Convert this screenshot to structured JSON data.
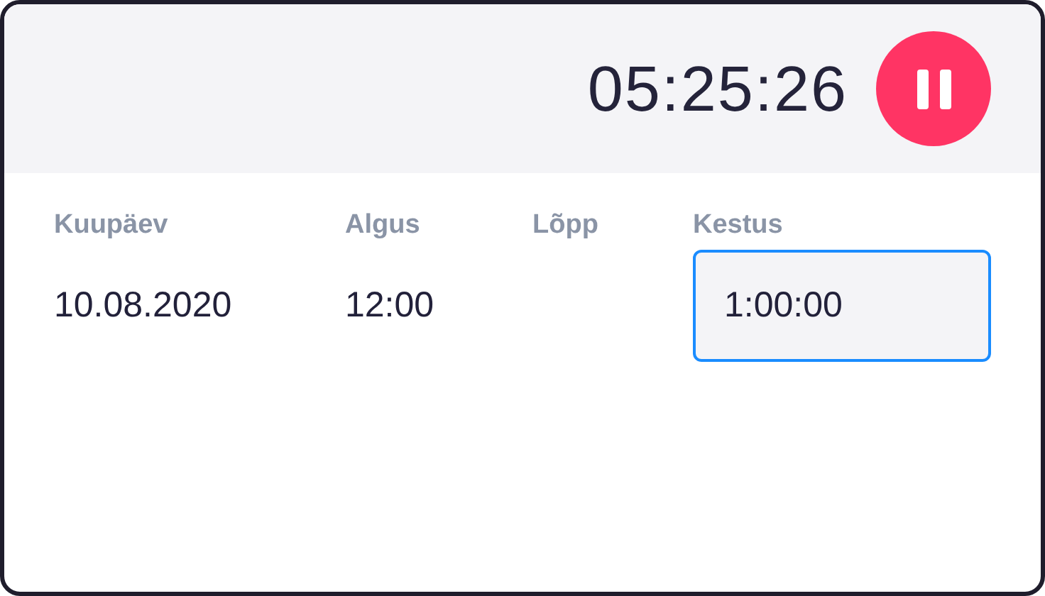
{
  "timer": {
    "time": "05:25:26",
    "running": true
  },
  "columns": [
    "Kuupäev",
    "Algus",
    "Lõpp",
    "Kestus"
  ],
  "entry": {
    "date": "10.08.2020",
    "start": "12:00",
    "duration": "1:00:00"
  }
}
